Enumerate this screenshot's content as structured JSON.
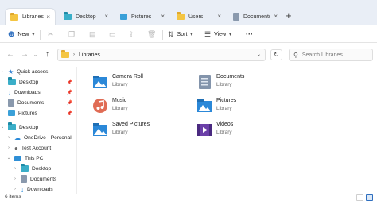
{
  "tabs": [
    {
      "label": "Libraries",
      "active": true
    },
    {
      "label": "Desktop",
      "active": false
    },
    {
      "label": "Pictures",
      "active": false
    },
    {
      "label": "Users",
      "active": false
    },
    {
      "label": "Documents",
      "active": false
    }
  ],
  "icons": {
    "close": "×",
    "new_tab": "+"
  },
  "toolbar": {
    "new_label": "New",
    "sort_label": "Sort",
    "view_label": "View",
    "more_label": "···"
  },
  "address": {
    "breadcrumb": "Libraries",
    "search_placeholder": "Search Libraries"
  },
  "sidebar": {
    "items": [
      {
        "label": "Quick access"
      },
      {
        "label": "Desktop"
      },
      {
        "label": "Downloads"
      },
      {
        "label": "Documents"
      },
      {
        "label": "Pictures"
      },
      {
        "label": "Desktop"
      },
      {
        "label": "OneDrive - Personal"
      },
      {
        "label": "Test Account"
      },
      {
        "label": "This PC"
      },
      {
        "label": "Desktop"
      },
      {
        "label": "Documents"
      },
      {
        "label": "Downloads"
      }
    ]
  },
  "libraries": [
    {
      "name": "Camera Roll",
      "type": "Library"
    },
    {
      "name": "Documents",
      "type": "Library"
    },
    {
      "name": "Music",
      "type": "Library"
    },
    {
      "name": "Pictures",
      "type": "Library"
    },
    {
      "name": "Saved Pictures",
      "type": "Library"
    },
    {
      "name": "Videos",
      "type": "Library"
    }
  ],
  "status": {
    "item_count": "6 items"
  },
  "colors": {
    "accent": "#2f6fbf",
    "tab_bg": "#e9eef6",
    "folder": "#f4c542"
  }
}
